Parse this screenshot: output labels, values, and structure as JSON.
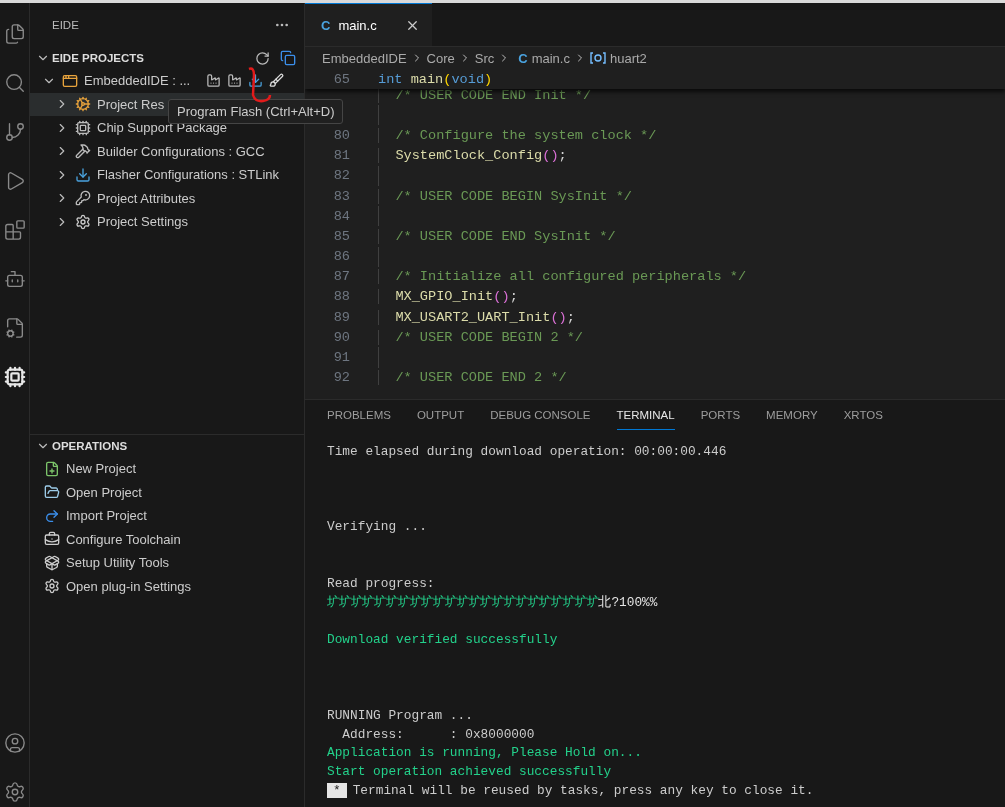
{
  "activity_bar": {
    "items": [
      {
        "selected": false
      },
      {
        "selected": false
      },
      {
        "selected": false
      },
      {
        "selected": false
      },
      {
        "selected": false
      },
      {
        "selected": false
      },
      {
        "selected": false
      },
      {
        "selected": true
      }
    ]
  },
  "sidebar": {
    "title": "EIDE",
    "projects_section": {
      "title": "EIDE PROJECTS",
      "expanded": true,
      "project": {
        "name": "EmbeddedIDE : ...",
        "expanded": true,
        "children": [
          {
            "label": "Project Res",
            "selected": true,
            "expanded": false
          },
          {
            "label": "Chip Support Package",
            "selected": false,
            "expanded": false
          },
          {
            "label": "Builder Configurations : GCC",
            "selected": false,
            "expanded": false
          },
          {
            "label": "Flasher Configurations : STLink",
            "selected": false,
            "expanded": false
          },
          {
            "label": "Project Attributes",
            "selected": false,
            "expanded": false
          },
          {
            "label": "Project Settings",
            "selected": false,
            "expanded": false
          }
        ]
      }
    },
    "operations_section": {
      "title": "OPERATIONS",
      "expanded": true,
      "items": [
        {
          "label": "New Project"
        },
        {
          "label": "Open Project"
        },
        {
          "label": "Import Project"
        },
        {
          "label": "Configure Toolchain"
        },
        {
          "label": "Setup Utility Tools"
        },
        {
          "label": "Open plug-in Settings"
        }
      ]
    }
  },
  "tooltip": {
    "text": "Program Flash (Ctrl+Alt+D)"
  },
  "editor": {
    "tab": {
      "file_icon": "C",
      "label": "main.c",
      "selected": true
    },
    "breadcrumb": [
      {
        "label": "EmbeddedIDE",
        "kind": "folder"
      },
      {
        "label": "Core",
        "kind": "folder"
      },
      {
        "label": "Src",
        "kind": "folder"
      },
      {
        "label": "main.c",
        "kind": "file",
        "file_icon": "C"
      },
      {
        "label": "huart2",
        "kind": "symbol"
      }
    ],
    "sticky_line": {
      "number": "65",
      "tokens": [
        {
          "text": "int ",
          "kind": "keyword"
        },
        {
          "text": "main",
          "kind": "function"
        },
        {
          "text": "(",
          "kind": "paren"
        },
        {
          "text": "void",
          "kind": "keyword"
        },
        {
          "text": ")",
          "kind": "paren"
        }
      ]
    },
    "lines": [
      {
        "indent": true,
        "tokens": [
          {
            "text": "/* USER CODE END Init */",
            "kind": "comment"
          }
        ]
      },
      {
        "kind": "blank"
      },
      {
        "number": "80",
        "indent": true,
        "tokens": [
          {
            "text": "/* Configure the system clock */",
            "kind": "comment"
          }
        ]
      },
      {
        "number": "81",
        "indent": true,
        "tokens": [
          {
            "text": "SystemClock_Config",
            "kind": "function"
          },
          {
            "text": "()",
            "kind": "paren2"
          },
          {
            "text": ";",
            "kind": "punct"
          }
        ]
      },
      {
        "number": "82",
        "kind": "blank"
      },
      {
        "number": "83",
        "indent": true,
        "tokens": [
          {
            "text": "/* USER CODE BEGIN SysInit */",
            "kind": "comment"
          }
        ]
      },
      {
        "number": "84",
        "kind": "blank"
      },
      {
        "number": "85",
        "indent": true,
        "tokens": [
          {
            "text": "/* USER CODE END SysInit */",
            "kind": "comment"
          }
        ]
      },
      {
        "number": "86",
        "kind": "blank"
      },
      {
        "number": "87",
        "indent": true,
        "tokens": [
          {
            "text": "/* Initialize all configured peripherals */",
            "kind": "comment"
          }
        ]
      },
      {
        "number": "88",
        "indent": true,
        "tokens": [
          {
            "text": "MX_GPIO_Init",
            "kind": "function"
          },
          {
            "text": "()",
            "kind": "paren2"
          },
          {
            "text": ";",
            "kind": "punct"
          }
        ]
      },
      {
        "number": "89",
        "indent": true,
        "tokens": [
          {
            "text": "MX_USART2_UART_Init",
            "kind": "function"
          },
          {
            "text": "()",
            "kind": "paren2"
          },
          {
            "text": ";",
            "kind": "punct"
          }
        ]
      },
      {
        "number": "90",
        "indent": true,
        "tokens": [
          {
            "text": "/* USER CODE BEGIN 2 */",
            "kind": "comment"
          }
        ]
      },
      {
        "number": "91",
        "kind": "blank"
      },
      {
        "number": "92",
        "indent": true,
        "tokens": [
          {
            "text": "/* USER CODE END 2 */",
            "kind": "comment"
          }
        ]
      }
    ]
  },
  "panel": {
    "tabs": [
      {
        "label": "PROBLEMS",
        "selected": false
      },
      {
        "label": "OUTPUT",
        "selected": false
      },
      {
        "label": "DEBUG CONSOLE",
        "selected": false
      },
      {
        "label": "TERMINAL",
        "selected": true
      },
      {
        "label": "PORTS",
        "selected": false
      },
      {
        "label": "MEMORY",
        "selected": false
      },
      {
        "label": "XRTOS",
        "selected": false
      }
    ],
    "terminal": [
      {
        "kind": "plain",
        "text": "Time elapsed during download operation: 00:00:00.446"
      },
      {
        "kind": "blank"
      },
      {
        "kind": "blank"
      },
      {
        "kind": "blank"
      },
      {
        "kind": "plain",
        "text": "Verifying ..."
      },
      {
        "kind": "blank"
      },
      {
        "kind": "blank"
      },
      {
        "kind": "plain",
        "text": "Read progress:"
      },
      {
        "kind": "progress",
        "text": "圹圹圹圹圹圹圹圹圹圹圹圹圹圹圹圹圹圹圹圹圹圹圹",
        "tail": "北?100%%"
      },
      {
        "kind": "blank"
      },
      {
        "kind": "success",
        "text": "Download verified successfully"
      },
      {
        "kind": "blank"
      },
      {
        "kind": "blank"
      },
      {
        "kind": "blank"
      },
      {
        "kind": "plain",
        "text": "RUNNING Program ..."
      },
      {
        "kind": "plain",
        "text": "  Address:      : 0x8000000"
      },
      {
        "kind": "success",
        "text": "Application is running, Please Hold on..."
      },
      {
        "kind": "success",
        "text": "Start operation achieved successfully"
      },
      {
        "kind": "notice",
        "badge": "*",
        "text": "Terminal will be reused by tasks, press any key to close it."
      }
    ]
  }
}
